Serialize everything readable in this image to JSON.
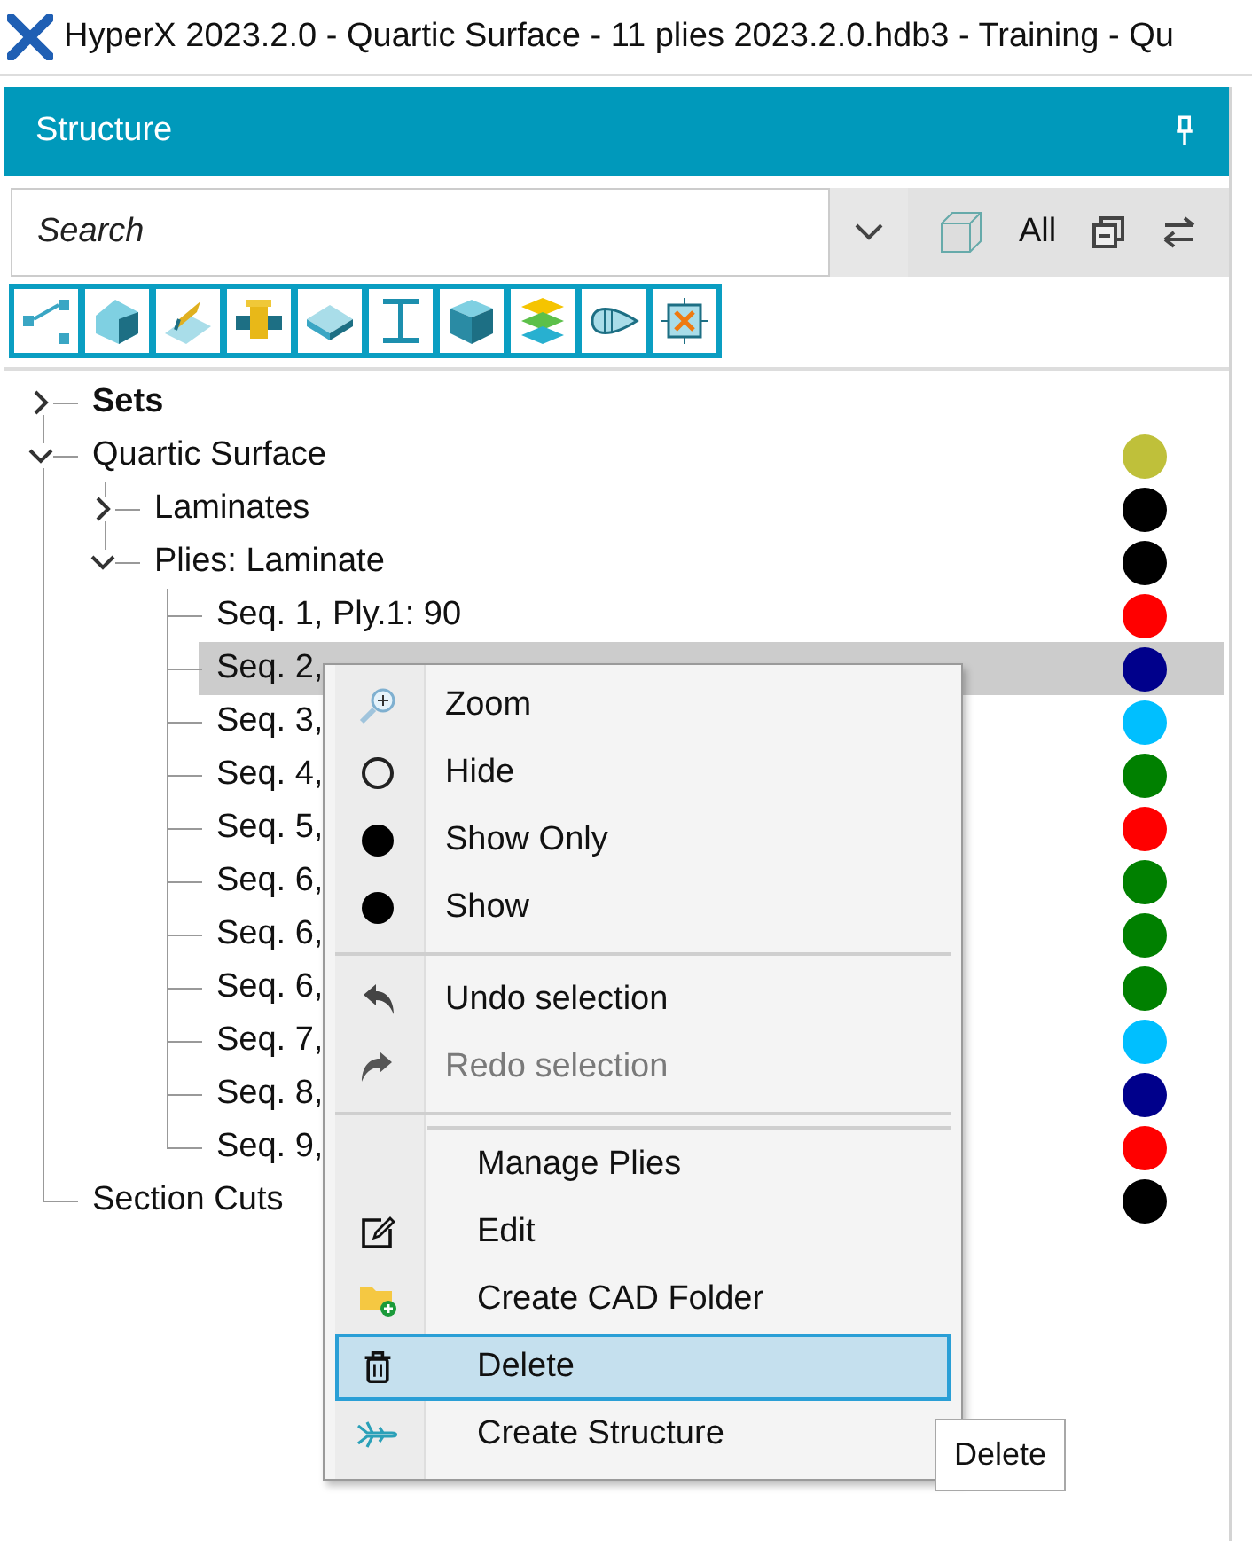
{
  "window": {
    "title": "HyperX 2023.2.0 - Quartic Surface - 11 plies 2023.2.0.hdb3 - Training - Qu"
  },
  "panel": {
    "title": "Structure"
  },
  "search": {
    "placeholder": "Search"
  },
  "filter": {
    "label": "All"
  },
  "tree": [
    {
      "label": "Sets",
      "bold": true,
      "expanded": false,
      "selected": false
    },
    {
      "label": "Quartic Surface",
      "expanded": true,
      "selected": false,
      "color": "#bfc03a",
      "children": [
        {
          "label": "Laminates",
          "expanded": false,
          "selected": false,
          "color": "#000000"
        },
        {
          "label": "Plies: Laminate",
          "expanded": true,
          "selected": false,
          "color": "#000000",
          "children": [
            {
              "label": "Seq. 1, Ply.1: 90",
              "selected": false,
              "color": "#ff0000"
            },
            {
              "label": "Seq. 2,",
              "selected": true,
              "color": "#00008b"
            },
            {
              "label": "Seq. 3,",
              "selected": false,
              "color": "#00bfff"
            },
            {
              "label": "Seq. 4,",
              "selected": false,
              "color": "#008000"
            },
            {
              "label": "Seq. 5,",
              "selected": false,
              "color": "#ff0000"
            },
            {
              "label": "Seq. 6,",
              "selected": false,
              "color": "#008000"
            },
            {
              "label": "Seq. 6,",
              "selected": false,
              "color": "#008000"
            },
            {
              "label": "Seq. 6,",
              "selected": false,
              "color": "#008000"
            },
            {
              "label": "Seq. 7,",
              "selected": false,
              "color": "#00bfff"
            },
            {
              "label": "Seq. 8,",
              "selected": false,
              "color": "#00008b"
            },
            {
              "label": "Seq. 9,",
              "selected": false,
              "color": "#ff0000"
            }
          ]
        }
      ]
    },
    {
      "label": "Section Cuts",
      "selected": false,
      "color": "#000000"
    }
  ],
  "context_menu": {
    "sections": [
      {
        "kind": "plain",
        "items": [
          {
            "kind": "zoom",
            "label": "Zoom",
            "disabled": false,
            "selected": false
          },
          {
            "kind": "hide",
            "label": "Hide",
            "disabled": false,
            "selected": false
          },
          {
            "kind": "show_only",
            "label": "Show Only",
            "disabled": false,
            "selected": false
          },
          {
            "kind": "show",
            "label": "Show",
            "disabled": false,
            "selected": false
          }
        ]
      },
      {
        "kind": "plain",
        "items": [
          {
            "kind": "undo",
            "label": "Undo selection",
            "disabled": false,
            "selected": false
          },
          {
            "kind": "redo",
            "label": "Redo selection",
            "disabled": true,
            "selected": false
          }
        ]
      },
      {
        "kind": "nested",
        "items": [
          {
            "kind": "none",
            "label": "Manage Plies",
            "disabled": false,
            "selected": false
          },
          {
            "kind": "edit",
            "label": "Edit",
            "disabled": false,
            "selected": false
          },
          {
            "kind": "folder",
            "label": "Create CAD Folder",
            "disabled": false,
            "selected": false
          },
          {
            "kind": "delete",
            "label": "Delete",
            "disabled": false,
            "selected": true
          },
          {
            "kind": "structure",
            "label": "Create Structure",
            "disabled": false,
            "selected": false
          }
        ]
      }
    ]
  },
  "tooltip": {
    "text": "Delete"
  }
}
